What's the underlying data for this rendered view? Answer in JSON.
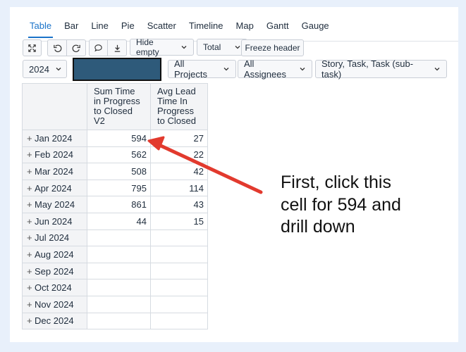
{
  "tabs": [
    "Table",
    "Bar",
    "Line",
    "Pie",
    "Scatter",
    "Timeline",
    "Map",
    "Gantt",
    "Gauge"
  ],
  "toolbar": {
    "hide_empty": "Hide empty",
    "total": "Total",
    "freeze_header": "Freeze header"
  },
  "filters": {
    "year": "2024",
    "projects": "All Projects",
    "assignees": "All Assignees",
    "issue_types": "Story, Task, Task (sub-task)"
  },
  "table": {
    "columns": [
      "Sum Time in Progress to Closed V2",
      "Avg Lead Time In Progress to Closed"
    ],
    "rows": [
      {
        "label": "Jan 2024",
        "sum": "594",
        "avg": "27"
      },
      {
        "label": "Feb 2024",
        "sum": "562",
        "avg": "22"
      },
      {
        "label": "Mar 2024",
        "sum": "508",
        "avg": "42"
      },
      {
        "label": "Apr 2024",
        "sum": "795",
        "avg": "114"
      },
      {
        "label": "May 2024",
        "sum": "861",
        "avg": "43"
      },
      {
        "label": "Jun 2024",
        "sum": "44",
        "avg": "15"
      },
      {
        "label": "Jul 2024",
        "sum": "",
        "avg": ""
      },
      {
        "label": "Aug 2024",
        "sum": "",
        "avg": ""
      },
      {
        "label": "Sep 2024",
        "sum": "",
        "avg": ""
      },
      {
        "label": "Oct 2024",
        "sum": "",
        "avg": ""
      },
      {
        "label": "Nov 2024",
        "sum": "",
        "avg": ""
      },
      {
        "label": "Dec 2024",
        "sum": "",
        "avg": ""
      }
    ]
  },
  "annotation": {
    "text": "First, click this cell for 594 and drill down"
  },
  "colors": {
    "accent": "#1a73c9",
    "arrow": "#e23a2e",
    "redaction": "#2e5a7a"
  }
}
